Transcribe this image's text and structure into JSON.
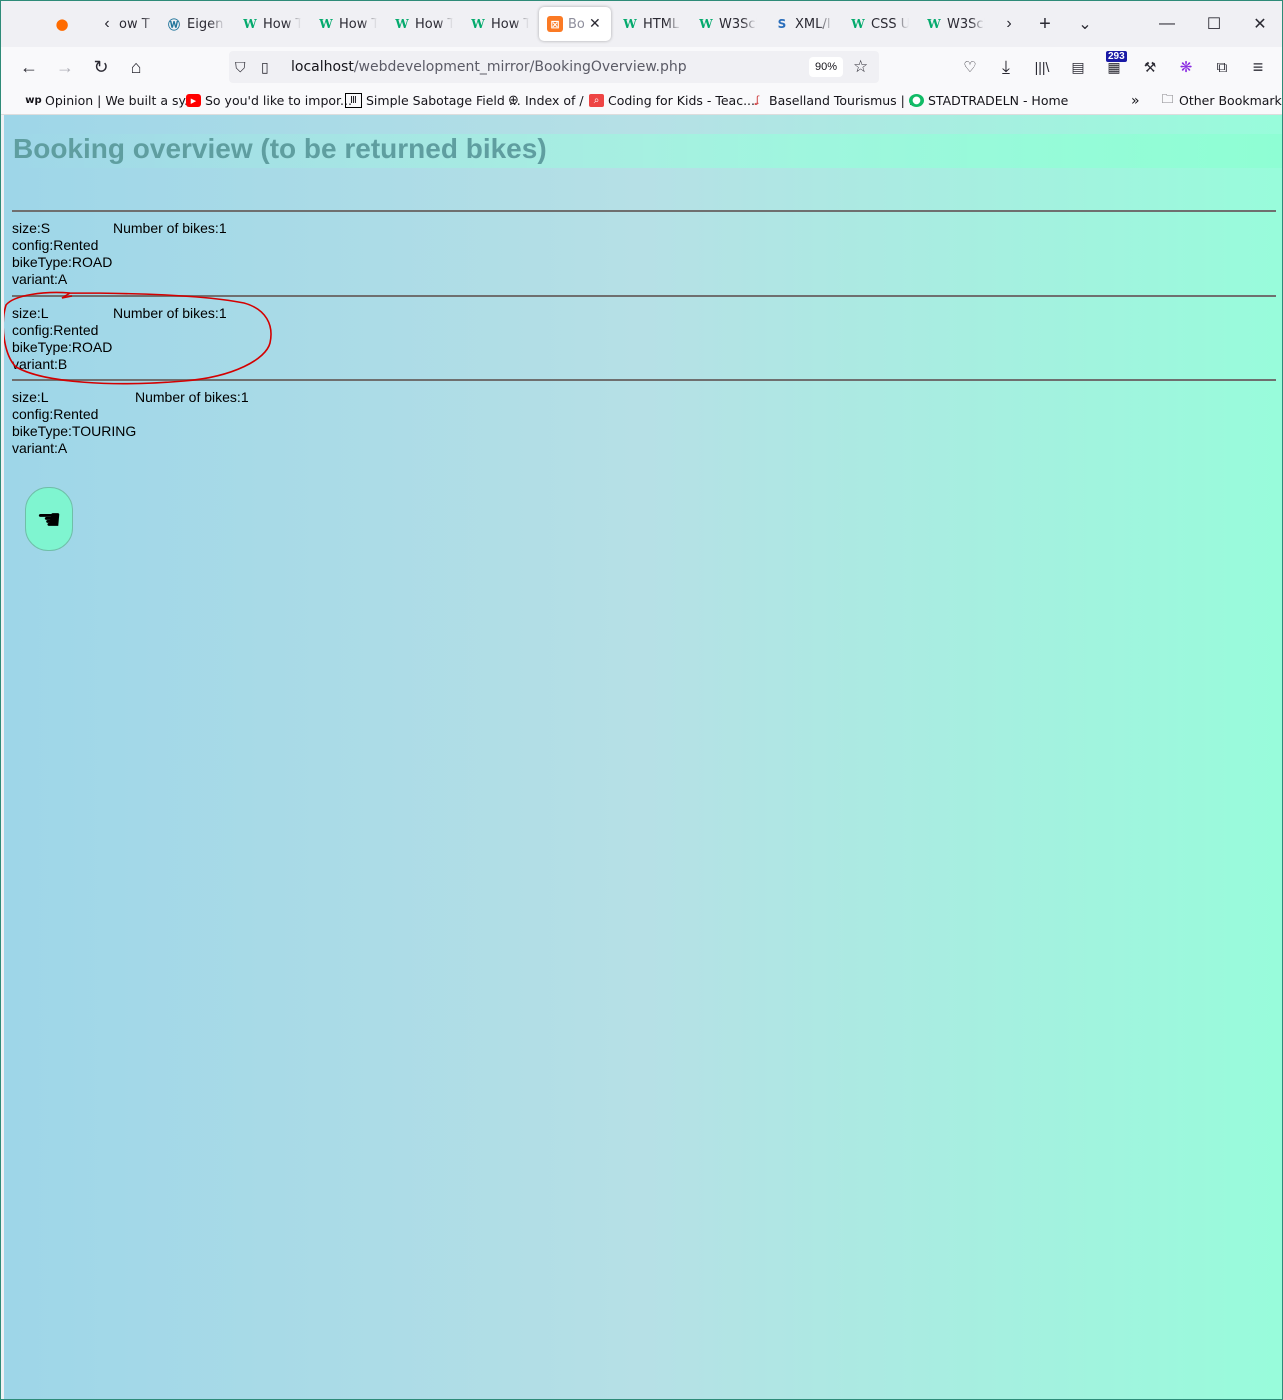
{
  "browser": {
    "tabs": [
      {
        "icon": "firefox-icon",
        "label": ""
      },
      {
        "icon": "generic-page-icon",
        "label": "ow T"
      },
      {
        "icon": "wordpress-icon",
        "label": "Eigen"
      },
      {
        "icon": "w3schools-icon",
        "label": "How T"
      },
      {
        "icon": "w3schools-icon",
        "label": "How T"
      },
      {
        "icon": "w3schools-icon",
        "label": "How T"
      },
      {
        "icon": "w3schools-icon",
        "label": "How T"
      },
      {
        "icon": "xampp-icon",
        "label": "Bo"
      },
      {
        "icon": "w3schools-icon",
        "label": "HTML"
      },
      {
        "icon": "w3schools-icon",
        "label": "W3Scl"
      },
      {
        "icon": "xml-icon",
        "label": "XML/I"
      },
      {
        "icon": "w3schools-icon",
        "label": "CSS U"
      },
      {
        "icon": "w3schools-icon",
        "label": "W3Scl"
      }
    ],
    "url_host": "localhost",
    "url_path": "/webdevelopment_mirror/BookingOverview.php",
    "zoom": "90%",
    "extension_badge": "293",
    "bookmarks": [
      "Opinion | We built a sy...",
      "So you'd like to impor...",
      "Simple Sabotage Field ...",
      "Index of /",
      "Coding for Kids - Teac...",
      "Baselland Tourismus | ...",
      "STADTRADELN - Home"
    ],
    "other_bookmarks": "Other Bookmarks",
    "bm_icon_label": "wp"
  },
  "page": {
    "title": "Booking overview (to be returned bikes)",
    "bookings": [
      {
        "size": "size:S",
        "config": "config:Rented",
        "bikeType": "bikeType:ROAD",
        "variant": "variant:A",
        "count": "Number of bikes:1"
      },
      {
        "size": "size:L",
        "config": "config:Rented",
        "bikeType": "bikeType:ROAD",
        "variant": "variant:B",
        "count": "Number of bikes:1"
      },
      {
        "size": "size:L",
        "config": "config:Rented",
        "bikeType": "bikeType:TOURING",
        "variant": "variant:A",
        "count": "Number of bikes:1"
      }
    ],
    "back_button_icon": "pointing-hand-left-icon",
    "back_button_glyph": "☚"
  },
  "colors": {
    "title": "#5f9ea0",
    "annotation": "#d40000",
    "button_bg": "#7ff5d0"
  }
}
